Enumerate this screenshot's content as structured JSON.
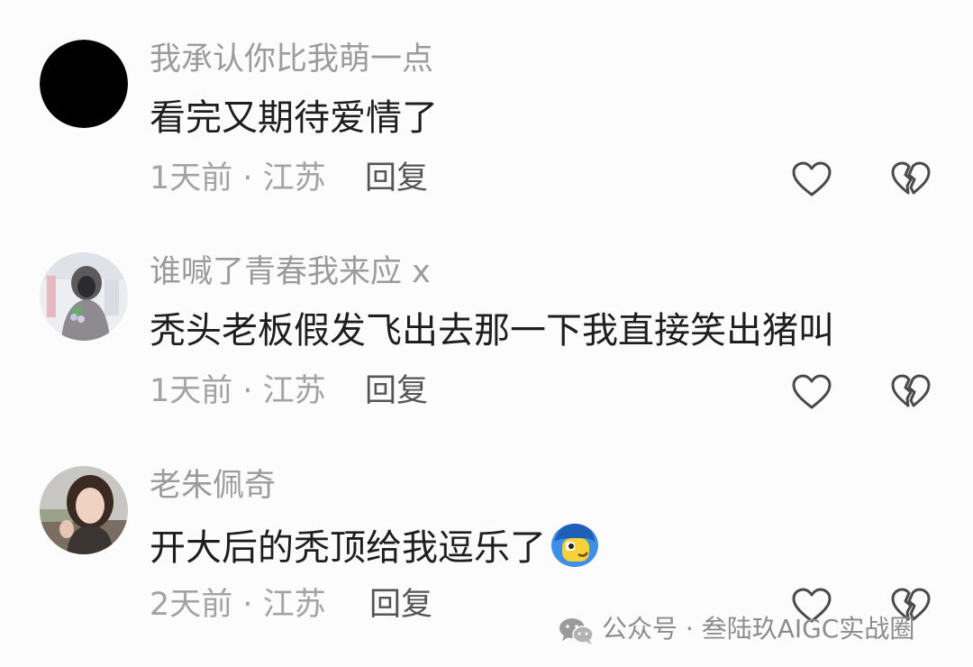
{
  "comments": [
    {
      "username": "我承认你比我萌一点",
      "text": "看完又期待爱情了",
      "meta": "1天前 · 江苏",
      "reply": "回复"
    },
    {
      "username": "谁喊了青春我来应 x",
      "text": "秃头老板假发飞出去那一下我直接笑出猪叫",
      "meta": "1天前 · 江苏",
      "reply": "回复"
    },
    {
      "username": "老朱佩奇",
      "text": "开大后的秃顶给我逗乐了",
      "meta": "2天前 · 江苏",
      "reply": "回复"
    }
  ],
  "watermark": {
    "text": "公众号 · 叁陆玖AIGC实战圈",
    "icon": "wechat-icon"
  },
  "icons": {
    "like": "heart-outline-icon",
    "dislike": "broken-heart-icon",
    "emoji": "face-emoji-icon"
  },
  "colors": {
    "background": "#fcfcfc",
    "username": "#9b9b9b",
    "text": "#1e1e1e",
    "meta": "#a3a3a3",
    "reply": "#555555"
  }
}
